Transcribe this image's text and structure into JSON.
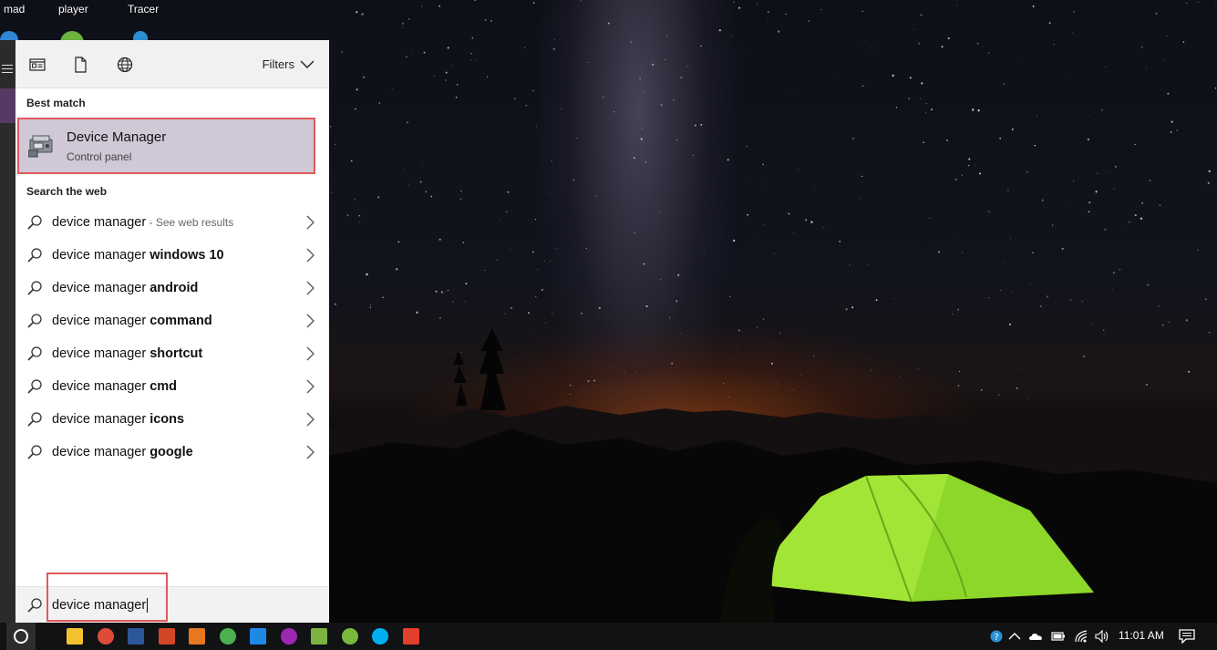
{
  "desktop": {
    "icon_labels": [
      "mad",
      "player",
      "Tracer"
    ]
  },
  "search_panel": {
    "toolbar": {
      "filters_label": "Filters",
      "icons": [
        "apps-icon",
        "documents-icon",
        "web-icon"
      ]
    },
    "best_match": {
      "heading": "Best match",
      "title": "Device Manager",
      "subtitle": "Control panel",
      "icon": "device-manager-icon"
    },
    "web": {
      "heading": "Search the web",
      "suggestions": [
        {
          "prefix": "device manager",
          "bold": "",
          "suffix": " - See web results"
        },
        {
          "prefix": "device manager ",
          "bold": "windows 10",
          "suffix": ""
        },
        {
          "prefix": "device manager ",
          "bold": "android",
          "suffix": ""
        },
        {
          "prefix": "device manager ",
          "bold": "command",
          "suffix": ""
        },
        {
          "prefix": "device manager ",
          "bold": "shortcut",
          "suffix": ""
        },
        {
          "prefix": "device manager ",
          "bold": "cmd",
          "suffix": ""
        },
        {
          "prefix": "device manager ",
          "bold": "icons",
          "suffix": ""
        },
        {
          "prefix": "device manager ",
          "bold": "google",
          "suffix": ""
        }
      ]
    },
    "search_box": {
      "value": "device manager"
    }
  },
  "taskbar": {
    "apps": [
      "file-explorer-icon",
      "chrome-icon",
      "word-icon",
      "powerpoint-icon",
      "matlab-icon",
      "app-icon",
      "edge-icon",
      "app-icon",
      "android-studio-icon",
      "utorrent-icon",
      "skype-icon",
      "sublime-icon"
    ],
    "app_colors": [
      "#f2c230",
      "#dd4b39",
      "#2b579a",
      "#d24726",
      "#e87722",
      "#4caf50",
      "#1e88e5",
      "#9c27b0",
      "#7cb342",
      "#78b83d",
      "#00aff0",
      "#e2402a"
    ],
    "clock": "11:01 AM"
  }
}
